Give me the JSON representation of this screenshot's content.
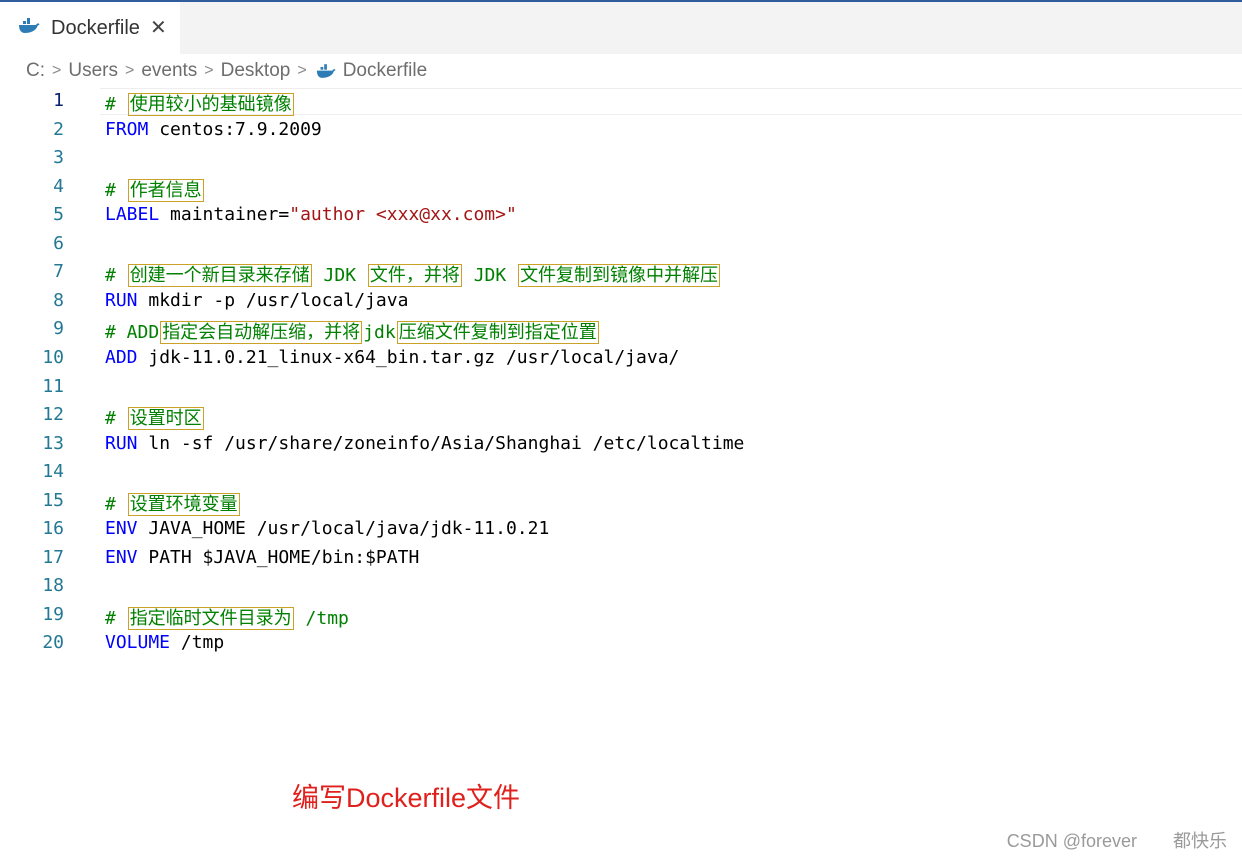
{
  "tab": {
    "label": "Dockerfile",
    "icon": "docker-whale-icon",
    "close_glyph": "✕"
  },
  "breadcrumb": {
    "parts": [
      "C:",
      "Users",
      "events",
      "Desktop",
      "Dockerfile"
    ],
    "separator": ">"
  },
  "editor": {
    "active_line": 1,
    "lines": [
      {
        "n": "1",
        "tokens": [
          {
            "t": "# ",
            "c": "cm"
          },
          {
            "t": "使用较小的基础镜像",
            "c": "cjk"
          }
        ]
      },
      {
        "n": "2",
        "tokens": [
          {
            "t": "FROM",
            "c": "kw"
          },
          {
            "t": " centos:7.9.2009",
            "c": ""
          }
        ]
      },
      {
        "n": "3",
        "tokens": []
      },
      {
        "n": "4",
        "tokens": [
          {
            "t": "# ",
            "c": "cm"
          },
          {
            "t": "作者信息",
            "c": "cjk"
          }
        ]
      },
      {
        "n": "5",
        "tokens": [
          {
            "t": "LABEL",
            "c": "kw"
          },
          {
            "t": " maintainer=",
            "c": ""
          },
          {
            "t": "\"author <xxx@xx.com>\"",
            "c": "str"
          }
        ]
      },
      {
        "n": "6",
        "tokens": []
      },
      {
        "n": "7",
        "tokens": [
          {
            "t": "# ",
            "c": "cm"
          },
          {
            "t": "创建一个新目录来存储",
            "c": "cjk"
          },
          {
            "t": " JDK ",
            "c": "cm"
          },
          {
            "t": "文件，并将",
            "c": "cjk"
          },
          {
            "t": " JDK ",
            "c": "cm"
          },
          {
            "t": "文件复制到镜像中并解压",
            "c": "cjk"
          }
        ]
      },
      {
        "n": "8",
        "tokens": [
          {
            "t": "RUN",
            "c": "kw"
          },
          {
            "t": " mkdir -p /usr/local/java",
            "c": ""
          }
        ]
      },
      {
        "n": "9",
        "tokens": [
          {
            "t": "# ADD",
            "c": "cm"
          },
          {
            "t": "指定会自动解压缩，并将",
            "c": "cjk"
          },
          {
            "t": "jdk",
            "c": "cm"
          },
          {
            "t": "压缩文件复制到指定位置",
            "c": "cjk"
          }
        ]
      },
      {
        "n": "10",
        "tokens": [
          {
            "t": "ADD",
            "c": "kw"
          },
          {
            "t": " jdk-11.0.21_linux-x64_bin.tar.gz /usr/local/java/",
            "c": ""
          }
        ]
      },
      {
        "n": "11",
        "tokens": []
      },
      {
        "n": "12",
        "tokens": [
          {
            "t": "# ",
            "c": "cm"
          },
          {
            "t": "设置时区",
            "c": "cjk"
          }
        ]
      },
      {
        "n": "13",
        "tokens": [
          {
            "t": "RUN",
            "c": "kw"
          },
          {
            "t": " ln -sf /usr/share/zoneinfo/Asia/Shanghai /etc/localtime",
            "c": ""
          }
        ]
      },
      {
        "n": "14",
        "tokens": []
      },
      {
        "n": "15",
        "tokens": [
          {
            "t": "# ",
            "c": "cm"
          },
          {
            "t": "设置环境变量",
            "c": "cjk"
          }
        ]
      },
      {
        "n": "16",
        "tokens": [
          {
            "t": "ENV",
            "c": "kw"
          },
          {
            "t": " JAVA_HOME /usr/local/java/jdk-11.0.21",
            "c": ""
          }
        ]
      },
      {
        "n": "17",
        "tokens": [
          {
            "t": "ENV",
            "c": "kw"
          },
          {
            "t": " PATH $JAVA_HOME/bin:$PATH",
            "c": ""
          }
        ]
      },
      {
        "n": "18",
        "tokens": []
      },
      {
        "n": "19",
        "tokens": [
          {
            "t": "# ",
            "c": "cm"
          },
          {
            "t": "指定临时文件目录为",
            "c": "cjk"
          },
          {
            "t": " /tmp",
            "c": "cm"
          }
        ]
      },
      {
        "n": "20",
        "tokens": [
          {
            "t": "VOLUME",
            "c": "kw"
          },
          {
            "t": " /tmp",
            "c": ""
          }
        ]
      }
    ]
  },
  "annotation": {
    "text": "编写Dockerfile文件",
    "color": "#e0201c"
  },
  "watermark": {
    "text": "CSDN @forever　　都快乐"
  },
  "colors": {
    "keyword": "#0000ff",
    "string": "#a31515",
    "comment": "#008000",
    "line_number": "#237893",
    "docker_icon": "#2e7cb5"
  }
}
